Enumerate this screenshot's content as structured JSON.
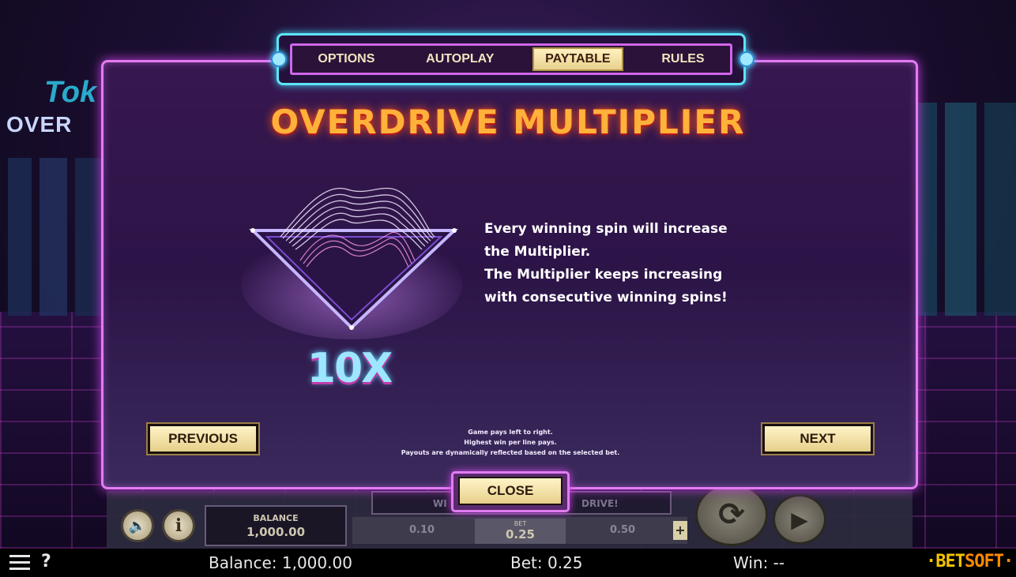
{
  "background": {
    "logo_script": "Tok",
    "logo_block": "OVER"
  },
  "tabs": [
    {
      "label": "OPTIONS",
      "active": false
    },
    {
      "label": "AUTOPLAY",
      "active": false
    },
    {
      "label": "PAYTABLE",
      "active": true
    },
    {
      "label": "RULES",
      "active": false
    }
  ],
  "paytable": {
    "title": "OVERDRIVE MULTIPLIER",
    "multiplier": "10X",
    "description": [
      "Every winning spin will increase",
      "the Multiplier.",
      "The Multiplier keeps increasing",
      "with consecutive winning spins!"
    ],
    "notes": [
      "Game pays left to right.",
      "Highest win per line pays.",
      "Payouts are dynamically reflected based on the selected bet."
    ],
    "previous_label": "PREVIOUS",
    "next_label": "NEXT",
    "close_label": "CLOSE"
  },
  "controls": {
    "balance_label": "BALANCE",
    "balance_value": "1,000.00",
    "mid_left": "WI",
    "mid_right": "DRIVE!",
    "bet_options": [
      "0.10",
      "0.50"
    ],
    "bet_label": "BET",
    "bet_value": "0.25",
    "minus": "-",
    "plus": "+"
  },
  "statusbar": {
    "help": "?",
    "balance": "Balance: 1,000.00",
    "bet": "Bet: 0.25",
    "win": "Win: --",
    "brand_bet": "·BET",
    "brand_soft": "SOFT·"
  },
  "colors": {
    "panel_border": "#e27cf2",
    "tab_frame": "#5ee4f7",
    "title": "#ffb23a",
    "multiplier": "#9ee6ff",
    "button_fill": "#fff4c8",
    "brand": "#f5c400"
  }
}
